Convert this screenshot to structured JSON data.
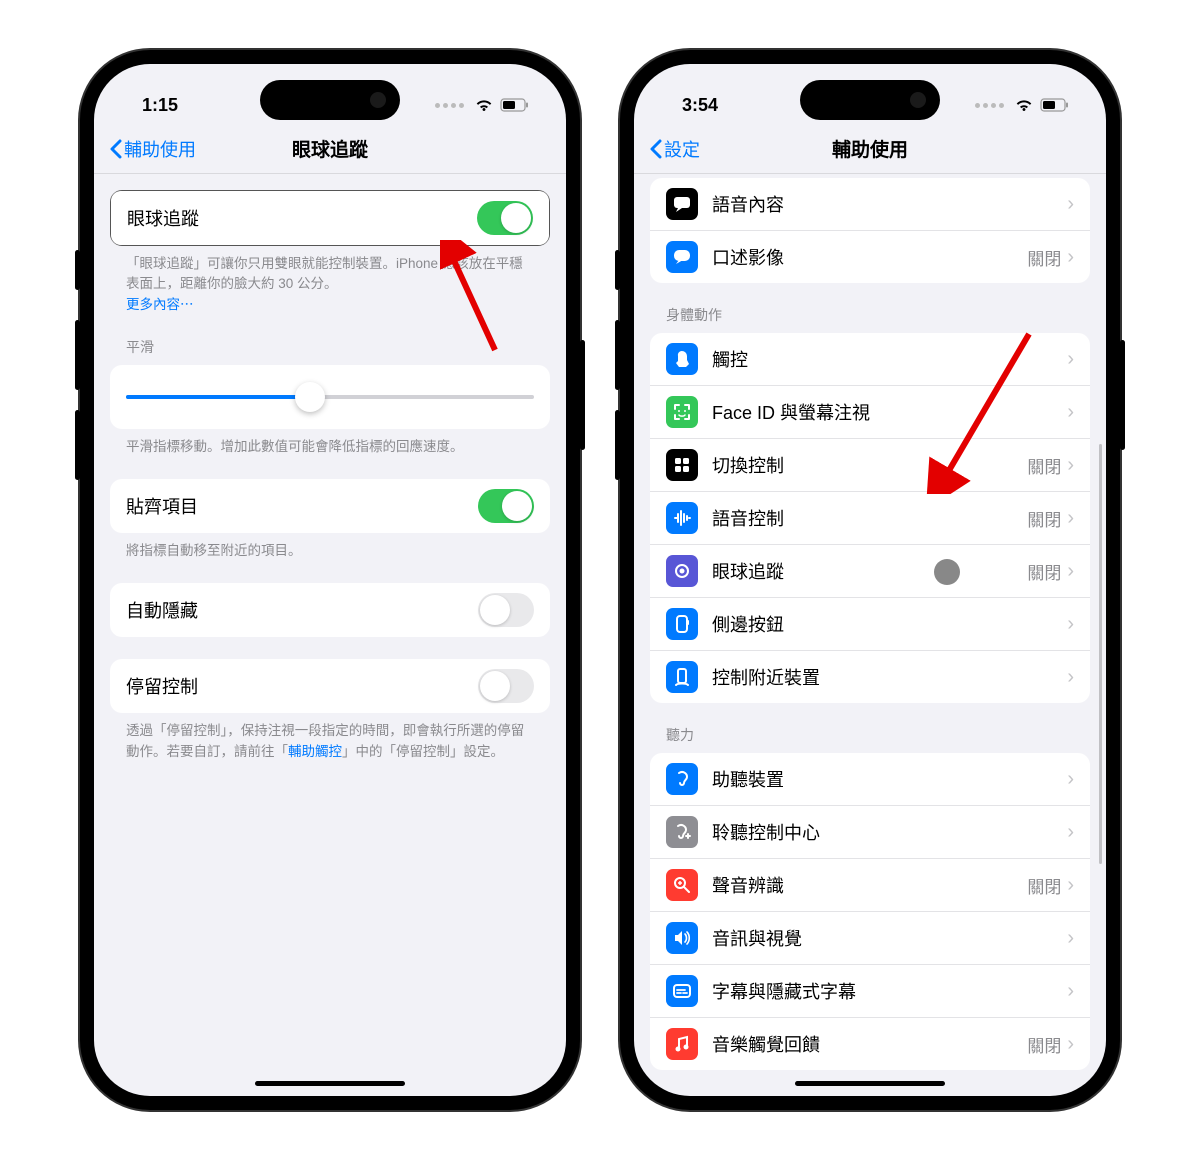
{
  "left": {
    "status_time": "1:15",
    "nav_back": "輔助使用",
    "nav_title": "眼球追蹤",
    "eye_tracking_label": "眼球追蹤",
    "eye_tracking_desc": "「眼球追蹤」可讓你只用雙眼就能控制裝置。iPhone 應該放在平穩表面上，距離你的臉大約 30 公分。",
    "more_link": "更多內容⋯",
    "smooth_header": "平滑",
    "smooth_footer": "平滑指標移動。增加此數值可能會降低指標的回應速度。",
    "snap_label": "貼齊項目",
    "snap_footer": "將指標自動移至附近的項目。",
    "autohide_label": "自動隱藏",
    "dwell_label": "停留控制",
    "dwell_footer_1": "透過「停留控制」，保持注視一段指定的時間，即會執行所選的停留動作。若要自訂，請前往「",
    "dwell_footer_link": "輔助觸控",
    "dwell_footer_2": "」中的「停留控制」設定。"
  },
  "right": {
    "status_time": "3:54",
    "nav_back": "設定",
    "nav_title": "輔助使用",
    "top_items": [
      {
        "label": "語音內容",
        "status": "",
        "icon": "speech-balloon",
        "color": "#000"
      },
      {
        "label": "口述影像",
        "status": "關閉",
        "icon": "chat-bubble",
        "color": "#007aff"
      }
    ],
    "body_header": "身體動作",
    "body_items": [
      {
        "label": "觸控",
        "status": "",
        "icon": "touch",
        "color": "#007aff"
      },
      {
        "label": "Face ID 與螢幕注視",
        "status": "",
        "icon": "face-id",
        "color": "#34c759"
      },
      {
        "label": "切換控制",
        "status": "關閉",
        "icon": "grid",
        "color": "#000"
      },
      {
        "label": "語音控制",
        "status": "關閉",
        "icon": "waveform",
        "color": "#007aff"
      },
      {
        "label": "眼球追蹤",
        "status": "關閉",
        "icon": "eye-track",
        "color": "#5856d6"
      },
      {
        "label": "側邊按鈕",
        "status": "",
        "icon": "side-button",
        "color": "#007aff"
      },
      {
        "label": "控制附近裝置",
        "status": "",
        "icon": "nearby",
        "color": "#007aff"
      }
    ],
    "hearing_header": "聽力",
    "hearing_items": [
      {
        "label": "助聽裝置",
        "status": "",
        "icon": "ear",
        "color": "#007aff"
      },
      {
        "label": "聆聽控制中心",
        "status": "",
        "icon": "hearing-cc",
        "color": "#8e8e93"
      },
      {
        "label": "聲音辨識",
        "status": "關閉",
        "icon": "sound-recog",
        "color": "#ff3b30"
      },
      {
        "label": "音訊與視覺",
        "status": "",
        "icon": "audio-visual",
        "color": "#007aff"
      },
      {
        "label": "字幕與隱藏式字幕",
        "status": "",
        "icon": "captions",
        "color": "#007aff"
      },
      {
        "label": "音樂觸覺回饋",
        "status": "關閉",
        "icon": "music-haptics",
        "color": "#ff3b30"
      }
    ]
  },
  "status_off": "關閉"
}
